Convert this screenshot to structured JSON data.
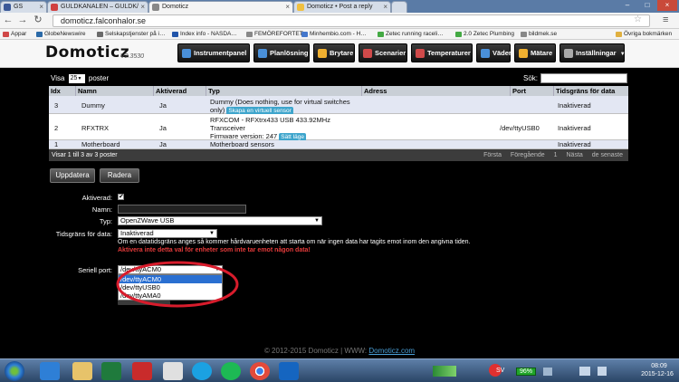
{
  "browser": {
    "tabs": [
      {
        "label": "GS",
        "icon_color": "#3b5998"
      },
      {
        "label": "GULDKANALEN – GULDK/",
        "icon_color": "#d04040"
      },
      {
        "label": "Domoticz",
        "icon_color": "#888888"
      },
      {
        "label": "Domoticz • Post a reply",
        "icon_color": "#f0c040"
      },
      {
        "label": "",
        "icon_color": "#bbbbbb"
      }
    ],
    "url": "domoticz.falconhalor.se",
    "bookmarks": [
      {
        "label": "Appar",
        "icon_color": "#d04848"
      },
      {
        "label": "GlobeNewswire",
        "icon_color": "#2b6aa8"
      },
      {
        "label": "Selskapstjenster på i…",
        "icon_color": "#6a6a6a"
      },
      {
        "label": "Index info - NASDA…",
        "icon_color": "#2255aa"
      },
      {
        "label": "FEMÖREFORTET",
        "icon_color": "#888888"
      },
      {
        "label": "Minhembio.com - H…",
        "icon_color": "#4477cc"
      },
      {
        "label": "Zetec running raceli…",
        "icon_color": "#44aa44"
      },
      {
        "label": "2.0 Zetec Plumbing",
        "icon_color": "#44aa44"
      },
      {
        "label": "bildmek.se",
        "icon_color": "#888888"
      },
      {
        "label": "Övriga bokmärken",
        "icon_color": "#e0b040"
      }
    ]
  },
  "app": {
    "logo": "Domoticz",
    "version": "V2.3530",
    "nav": [
      {
        "label": "Instrumentpanel",
        "icon_color": "#4a90d9"
      },
      {
        "label": "Planlösning",
        "icon_color": "#4a90d9"
      },
      {
        "label": "Brytare",
        "icon_color": "#f0b030"
      },
      {
        "label": "Scenarier",
        "icon_color": "#d04a4a"
      },
      {
        "label": "Temperaturer",
        "icon_color": "#d04a4a"
      },
      {
        "label": "Väder",
        "icon_color": "#4a90d9"
      },
      {
        "label": "Mätare",
        "icon_color": "#f0b030"
      },
      {
        "label": "Inställningar",
        "icon_color": "#aaaaaa"
      }
    ]
  },
  "table": {
    "show_prefix": "Visa",
    "show_value": "25",
    "show_suffix": "poster",
    "search_label": "Sök:",
    "headers": [
      "Idx",
      "Namn",
      "Aktiverad",
      "Typ",
      "Adress",
      "Port",
      "Tidsgräns för data"
    ],
    "rows": [
      {
        "idx": "3",
        "name": "Dummy",
        "enabled": "Ja",
        "type_line1": "Dummy (Does nothing, use for virtual switches",
        "type_line2": "only)",
        "type_button": "Skapa en virtuell sensor",
        "type_line3": "",
        "address": "",
        "port": "",
        "timeout": "Inaktiverad"
      },
      {
        "idx": "2",
        "name": "RFXTRX",
        "enabled": "Ja",
        "type_line1": "RFXCOM - RFXtrx433 USB 433.92MHz",
        "type_line2": "Transceiver",
        "type_line3": "Firmware version: 247",
        "type_button": "Sätt läge",
        "address": "",
        "port": "/dev/ttyUSB0",
        "timeout": "Inaktiverad"
      },
      {
        "idx": "1",
        "name": "Motherboard",
        "enabled": "Ja",
        "type_line1": "Motherboard sensors",
        "address": "",
        "port": "",
        "timeout": "Inaktiverad"
      }
    ],
    "footer_info": "Visar 1 till 3 av 3 poster",
    "pager": [
      "Första",
      "Föregående",
      "1",
      "Nästa",
      "de senaste"
    ]
  },
  "actions": {
    "update": "Uppdatera",
    "delete": "Radera"
  },
  "form": {
    "enabled_label": "Aktiverad:",
    "enabled_checked": true,
    "name_label": "Namn:",
    "name_value": "",
    "type_label": "Typ:",
    "type_value": "OpenZWave USB",
    "timeout_label": "Tidsgräns för data:",
    "timeout_value": "Inaktiverad",
    "timeout_help": "Om en datatidsgräns anges så kommer hårdvaruenheten att starta om när ingen data har tagits emot inom den angivna tiden.",
    "timeout_warning": "Aktivera inte detta val för enheter som inte tar emot någon data!",
    "serial_label": "Seriell port:",
    "serial_value": "/dev/ttyACM0",
    "serial_options": [
      "/dev/ttyACM0",
      "/dev/ttyUSB0",
      "/dev/ttyAMA0"
    ],
    "serial_selected_index": 0
  },
  "footer": {
    "prefix": "© 2012-2015 Domoticz | WWW:",
    "link": "Domoticz.com"
  },
  "taskbar": {
    "apps": [
      {
        "name": "internet-explorer-icon",
        "color": "#2e7fd6"
      },
      {
        "name": "folder-icon",
        "color": "#e7c36a"
      },
      {
        "name": "excel-icon",
        "color": "#1f7a3c"
      },
      {
        "name": "pdf-icon",
        "color": "#c92b2b"
      },
      {
        "name": "paint-icon",
        "color": "#e0e0e0"
      },
      {
        "name": "skype-icon",
        "color": "#1ba1e2"
      },
      {
        "name": "spotify-icon",
        "color": "#1db954"
      },
      {
        "name": "chrome-icon",
        "color": "#e24a3b"
      },
      {
        "name": "outlook-icon",
        "color": "#1565c0"
      }
    ],
    "language": "SV",
    "battery": "96%",
    "time": "08:09",
    "date": "2015-12-16"
  },
  "colors": {
    "accent_selection": "#2a6fd1",
    "warning": "#e53b3b",
    "annotation_ellipse": "#d81c2c"
  }
}
